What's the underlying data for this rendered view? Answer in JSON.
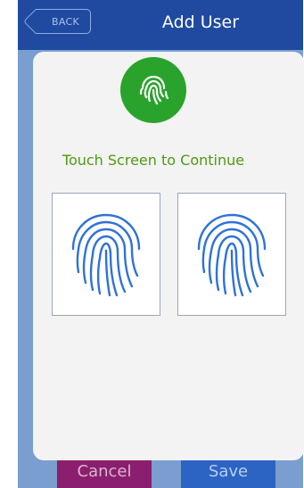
{
  "header": {
    "back_label": "BACK",
    "title": "Add User"
  },
  "modal": {
    "instruction": "Touch Screen to Continue"
  },
  "footer": {
    "cancel_label": "Cancel",
    "save_label": "Save"
  },
  "colors": {
    "header": "#1f4aa0",
    "badge": "#2aa32c",
    "instruction": "#4e9a12",
    "fingerprint": "#2f72d6",
    "cancel": "#8b1e6e",
    "save": "#2b64c3"
  },
  "icons": {
    "badge": "fingerprint-icon",
    "slot_1": "fingerprint-icon",
    "slot_2": "fingerprint-icon"
  }
}
